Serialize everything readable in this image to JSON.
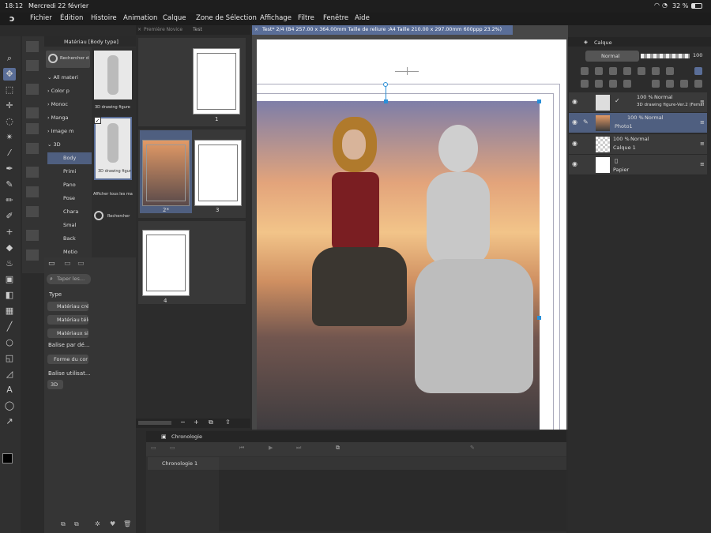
{
  "status": {
    "time": "18:12",
    "date": "Mercredi 22 février",
    "battery": "32 %"
  },
  "menu": [
    "Fichier",
    "Édition",
    "Histoire",
    "Animation",
    "Calque",
    "Zone de Sélection",
    "Affichage",
    "Filtre",
    "Fenêtre",
    "Aide"
  ],
  "material": {
    "tab": "Matériau [Body type]",
    "search_label": "Rechercher dans",
    "tree": [
      "All materi",
      "Color p",
      "Monoc",
      "Manga",
      "Image m",
      "3D",
      "Body",
      "Primi",
      "Pano",
      "Pose",
      "Chara",
      "Smal",
      "Back",
      "Motio"
    ],
    "item1": "3D drawing figure",
    "item2": "3D drawing figure",
    "show_all": "Afficher tous les ma",
    "search_btn": "Rechercher",
    "tag_search_placeholder": "Taper les...",
    "type_label": "Type",
    "type_opts": [
      "Matériau cré",
      "Matériau télé",
      "Matériaux si"
    ],
    "tag_label": "Balise par dé...",
    "tag_opt": "Forme du cor",
    "usage_label": "Balise utilisat...",
    "usage_opt": "3D"
  },
  "pages": {
    "tabs": [
      "Première Novice",
      "Test"
    ],
    "labels": [
      "1",
      "2*",
      "3",
      "4"
    ]
  },
  "canvas": {
    "tab": "Test* 2/4 (B4 257.00 x 364.00mm Taille de reliure :A4 Taille 210.00 x 297.00mm 600ppp 23.2%)"
  },
  "layers": {
    "tab": "Calque",
    "blend": "Normal",
    "opacity": "100",
    "rows": [
      {
        "pct": "100 %",
        "mode": "Normal",
        "name": "3D drawing figure-Ver.2 (Femal"
      },
      {
        "pct": "100 %",
        "mode": "Normal",
        "name": "Photo1"
      },
      {
        "pct": "100 %",
        "mode": "Normal",
        "name": "Calque 1"
      },
      {
        "pct": "",
        "mode": "",
        "name": "Papier"
      }
    ]
  },
  "timeline": {
    "tab": "Chronologie",
    "row": "Chronologie 1"
  },
  "colors": {
    "accent": "#5a6e98",
    "selected": "#4f5f80"
  }
}
